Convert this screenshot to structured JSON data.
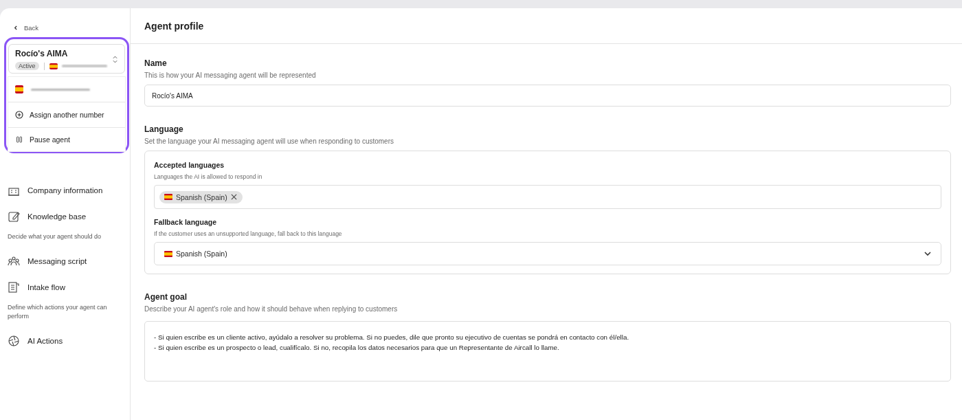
{
  "sidebar": {
    "back": "Back",
    "agent_switcher": {
      "name": "Rocío's AIMA",
      "status": "Active",
      "expanded": true,
      "menu": [
        {
          "kind": "number"
        },
        {
          "kind": "add",
          "label": "Assign another number"
        },
        {
          "kind": "pause",
          "label": "Pause agent"
        }
      ]
    },
    "sections": [
      {
        "items": [
          {
            "kind": "building",
            "label": "Company information"
          },
          {
            "kind": "notebook",
            "label": "Knowledge base"
          }
        ]
      },
      {
        "heading": "Decide what your agent should do",
        "items": [
          {
            "kind": "people",
            "label": "Messaging script"
          },
          {
            "kind": "form",
            "label": "Intake flow"
          }
        ]
      },
      {
        "heading": "Define which actions your agent can perform",
        "items": [
          {
            "kind": "aperture",
            "label": "AI Actions"
          }
        ]
      }
    ]
  },
  "page": {
    "title": "Agent profile",
    "name": {
      "label": "Name",
      "hint": "This is how your AI messaging agent will be represented",
      "value": "Rocío's AIMA"
    },
    "language": {
      "label": "Language",
      "hint": "Set the language your AI messaging agent will use when responding to customers",
      "accepted": {
        "label": "Accepted languages",
        "hint": "Languages the AI is allowed to respond in",
        "tags": [
          "Spanish (Spain)"
        ]
      },
      "fallback": {
        "label": "Fallback language",
        "hint": "If the customer uses an unsupported language, fall back to this language",
        "value": "Spanish (Spain)"
      }
    },
    "goal": {
      "label": "Agent goal",
      "hint": "Describe your AI agent's role and how it should behave when replying to customers",
      "value": "- Si quien escribe es un cliente activo, ayúdalo a resolver su problema. Si no puedes, dile que pronto su ejecutivo de cuentas se pondrá en contacto con él/ella.\n- Si quien escribe es un prospecto o lead, cualifícalo. Si no, recopila los datos necesarios para que un Representante de Aircall lo llame."
    }
  }
}
